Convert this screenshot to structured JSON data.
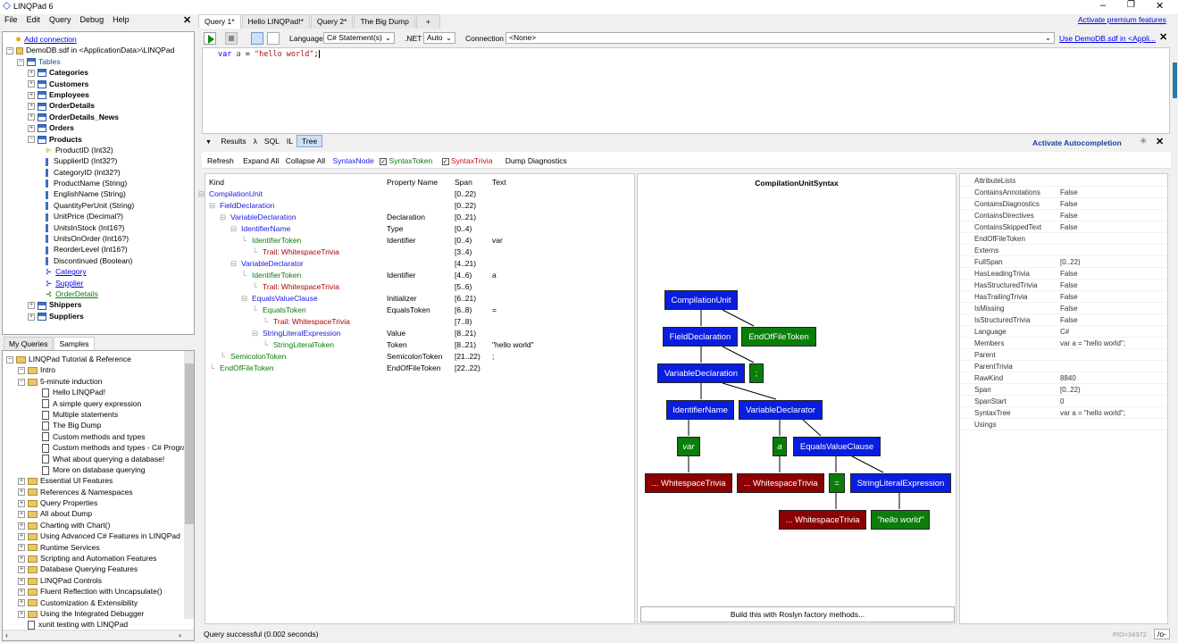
{
  "app": {
    "title": "LINQPad 6",
    "premium": "Activate premium features"
  },
  "menu": [
    "File",
    "Edit",
    "Query",
    "Debug",
    "Help"
  ],
  "tabs": [
    "Query 1*",
    "Hello LINQPad!*",
    "Query 2*",
    "The Big Dump",
    "+"
  ],
  "toolbar": {
    "language_label": "Language",
    "language_value": "C# Statement(s)",
    "net_label": ".NET",
    "net_value": "Auto",
    "connection_label": "Connection",
    "connection_value": "<None>",
    "use_db": "Use DemoDB.sdf in <Appli..."
  },
  "editor": {
    "code_kw": "var",
    "code_id": "a",
    "code_eq": "=",
    "code_str": "\"hello world\"",
    "code_end": ";"
  },
  "schema": {
    "add": "Add connection",
    "db": "DemoDB.sdf in <ApplicationData>\\LINQPad",
    "tables": "Tables",
    "items": [
      {
        "t": "Categories",
        "k": "table",
        "b": 1,
        "l": 1
      },
      {
        "t": "Customers",
        "k": "table",
        "b": 1,
        "l": 1
      },
      {
        "t": "Employees",
        "k": "table",
        "b": 1,
        "l": 1
      },
      {
        "t": "OrderDetails",
        "k": "table",
        "b": 1,
        "l": 1
      },
      {
        "t": "OrderDetails_News",
        "k": "table",
        "b": 1,
        "l": 1
      },
      {
        "t": "Orders",
        "k": "table",
        "b": 1,
        "l": 1
      },
      {
        "t": "Products",
        "k": "table",
        "b": 1,
        "l": 1
      },
      {
        "t": "ProductID (Int32)",
        "k": "key",
        "l": 2
      },
      {
        "t": "SupplierID (Int32?)",
        "k": "col",
        "l": 2
      },
      {
        "t": "CategoryID (Int32?)",
        "k": "col",
        "l": 2
      },
      {
        "t": "ProductName (String)",
        "k": "col",
        "l": 2
      },
      {
        "t": "EnglishName (String)",
        "k": "col",
        "l": 2
      },
      {
        "t": "QuantityPerUnit (String)",
        "k": "col",
        "l": 2
      },
      {
        "t": "UnitPrice (Decimal?)",
        "k": "col",
        "l": 2
      },
      {
        "t": "UnitsInStock (Int16?)",
        "k": "col",
        "l": 2
      },
      {
        "t": "UnitsOnOrder (Int16?)",
        "k": "col",
        "l": 2
      },
      {
        "t": "ReorderLevel (Int16?)",
        "k": "col",
        "l": 2
      },
      {
        "t": "Discontinued (Boolean)",
        "k": "col",
        "l": 2
      },
      {
        "t": "Category",
        "k": "rel",
        "l": 2
      },
      {
        "t": "Supplier",
        "k": "rel",
        "l": 2
      },
      {
        "t": "OrderDetails",
        "k": "relg",
        "l": 2
      },
      {
        "t": "Shippers",
        "k": "table",
        "b": 1,
        "l": 1
      },
      {
        "t": "Suppliers",
        "k": "table",
        "b": 1,
        "l": 1
      }
    ]
  },
  "lowertabs": [
    "My Queries",
    "Samples"
  ],
  "samples": [
    {
      "t": "LINQPad Tutorial & Reference",
      "k": "f",
      "l": 0
    },
    {
      "t": "Intro",
      "k": "f",
      "l": 1
    },
    {
      "t": "5-minute induction",
      "k": "f",
      "l": 1
    },
    {
      "t": "Hello LINQPad!",
      "k": "d",
      "l": 2
    },
    {
      "t": "A simple query expression",
      "k": "d",
      "l": 2
    },
    {
      "t": "Multiple statements",
      "k": "d",
      "l": 2
    },
    {
      "t": "The Big Dump",
      "k": "d",
      "l": 2
    },
    {
      "t": "Custom methods and types",
      "k": "d",
      "l": 2
    },
    {
      "t": "Custom methods and types - C# Progra",
      "k": "d",
      "l": 2
    },
    {
      "t": "What about querying a database!",
      "k": "d",
      "l": 2
    },
    {
      "t": "More on database querying",
      "k": "d",
      "l": 2
    },
    {
      "t": "Essential UI Features",
      "k": "f",
      "l": 1
    },
    {
      "t": "References & Namespaces",
      "k": "f",
      "l": 1
    },
    {
      "t": "Query Properties",
      "k": "f",
      "l": 1
    },
    {
      "t": "All about Dump",
      "k": "f",
      "l": 1
    },
    {
      "t": "Charting with Chart()",
      "k": "f",
      "l": 1
    },
    {
      "t": "Using Advanced C# Features in LINQPad",
      "k": "f",
      "l": 1
    },
    {
      "t": "Runtime Services",
      "k": "f",
      "l": 1
    },
    {
      "t": "Scripting and Automation Features",
      "k": "f",
      "l": 1
    },
    {
      "t": "Database Querying Features",
      "k": "f",
      "l": 1
    },
    {
      "t": "LINQPad Controls",
      "k": "f",
      "l": 1
    },
    {
      "t": "Fluent Reflection with Uncapsulate()",
      "k": "f",
      "l": 1
    },
    {
      "t": "Customization & Extensibility",
      "k": "f",
      "l": 1
    },
    {
      "t": "Using the Integrated Debugger",
      "k": "f",
      "l": 1
    },
    {
      "t": "xunit testing with LINQPad",
      "k": "d",
      "l": 1
    }
  ],
  "results": {
    "tabs": [
      "Results",
      "λ",
      "SQL",
      "IL",
      "Tree"
    ],
    "autocomp": "Activate Autocompletion",
    "buttons": [
      "Refresh",
      "Expand All",
      "Collapse All"
    ],
    "syntaxnode": "SyntaxNode",
    "syntaxtoken": "SyntaxToken",
    "syntaxtrivia": "SyntaxTrivia",
    "dump": "Dump Diagnostics",
    "cols": [
      "Kind",
      "Property Name",
      "Span",
      "Text"
    ],
    "rows": [
      {
        "k": "CompilationUnit",
        "c": "b",
        "i": 0,
        "p": "",
        "s": "[0..22)",
        "t": ""
      },
      {
        "k": "FieldDeclaration",
        "c": "b",
        "i": 1,
        "p": "",
        "s": "[0..22)",
        "t": ""
      },
      {
        "k": "VariableDeclaration",
        "c": "b",
        "i": 2,
        "p": "Declaration",
        "s": "[0..21)",
        "t": ""
      },
      {
        "k": "IdentifierName",
        "c": "b",
        "i": 3,
        "p": "Type",
        "s": "[0..4)",
        "t": ""
      },
      {
        "k": "IdentifierToken",
        "c": "g",
        "i": 4,
        "p": "Identifier",
        "s": "[0..4)",
        "t": "var"
      },
      {
        "k": "Trail: WhitespaceTrivia",
        "c": "r",
        "i": 5,
        "p": "",
        "s": "[3..4)",
        "t": ""
      },
      {
        "k": "VariableDeclarator",
        "c": "b",
        "i": 3,
        "p": "",
        "s": "[4..21)",
        "t": ""
      },
      {
        "k": "IdentifierToken",
        "c": "g",
        "i": 4,
        "p": "Identifier",
        "s": "[4..6)",
        "t": "a"
      },
      {
        "k": "Trail: WhitespaceTrivia",
        "c": "r",
        "i": 5,
        "p": "",
        "s": "[5..6)",
        "t": ""
      },
      {
        "k": "EqualsValueClause",
        "c": "b",
        "i": 4,
        "p": "Initializer",
        "s": "[6..21)",
        "t": ""
      },
      {
        "k": "EqualsToken",
        "c": "g",
        "i": 5,
        "p": "EqualsToken",
        "s": "[6..8)",
        "t": "="
      },
      {
        "k": "Trail: WhitespaceTrivia",
        "c": "r",
        "i": 6,
        "p": "",
        "s": "[7..8)",
        "t": ""
      },
      {
        "k": "StringLiteralExpression",
        "c": "b",
        "i": 5,
        "p": "Value",
        "s": "[8..21)",
        "t": ""
      },
      {
        "k": "StringLiteralToken",
        "c": "g",
        "i": 6,
        "p": "Token",
        "s": "[8..21)",
        "t": "\"hello world\""
      },
      {
        "k": "SemicolonToken",
        "c": "g",
        "i": 2,
        "p": "SemicolonToken",
        "s": "[21..22)",
        "t": ";"
      },
      {
        "k": "EndOfFileToken",
        "c": "g",
        "i": 1,
        "p": "EndOfFileToken",
        "s": "[22..22)",
        "t": ""
      }
    ],
    "graph_title": "CompilationUnitSyntax",
    "nodes": {
      "cu": "CompilationUnit",
      "fd": "FieldDeclaration",
      "eof": "EndOfFileToken",
      "vd": "VariableDeclaration",
      "semi": ";",
      "in": "IdentifierName",
      "vdr": "VariableDeclarator",
      "var": "var",
      "a": "a",
      "evc": "EqualsValueClause",
      "ws1": "... WhitespaceTrivia",
      "ws2": "... WhitespaceTrivia",
      "eq": "=",
      "sle": "StringLiteralExpression",
      "ws3": "... WhitespaceTrivia",
      "hw": "\"hello world\""
    },
    "build": "Build this with Roslyn factory methods...",
    "props": [
      [
        "AttributeLists",
        ""
      ],
      [
        "ContainsAnnotations",
        "False"
      ],
      [
        "ContainsDiagnostics",
        "False"
      ],
      [
        "ContainsDirectives",
        "False"
      ],
      [
        "ContainsSkippedText",
        "False"
      ],
      [
        "EndOfFileToken",
        ""
      ],
      [
        "Externs",
        ""
      ],
      [
        "FullSpan",
        "[0..22)"
      ],
      [
        "HasLeadingTrivia",
        "False"
      ],
      [
        "HasStructuredTrivia",
        "False"
      ],
      [
        "HasTrailingTrivia",
        "False"
      ],
      [
        "IsMissing",
        "False"
      ],
      [
        "IsStructuredTrivia",
        "False"
      ],
      [
        "Language",
        "C#"
      ],
      [
        "Members",
        "var a = \"hello world\";"
      ],
      [
        "Parent",
        ""
      ],
      [
        "ParentTrivia",
        ""
      ],
      [
        "RawKind",
        "8840"
      ],
      [
        "Span",
        "[0..22)"
      ],
      [
        "SpanStart",
        "0"
      ],
      [
        "SyntaxTree",
        "var a = \"hello world\";"
      ],
      [
        "Usings",
        ""
      ]
    ]
  },
  "status": {
    "text": "Query successful  (0.002 seconds)",
    "pid": "PID=34372",
    "mode": "/o-"
  }
}
